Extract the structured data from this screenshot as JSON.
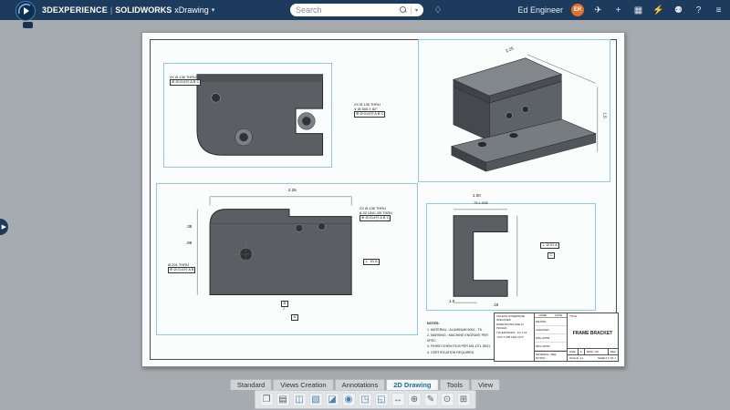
{
  "topbar": {
    "brand": {
      "name": "3DEXPERIENCE",
      "divider": "|",
      "app": "SOLIDWORKS",
      "doc": "xDrawing",
      "caret": "▾"
    },
    "search": {
      "placeholder": "Search",
      "chevron": "▾",
      "tag_glyph": "♢"
    },
    "user": {
      "name": "Ed Engineer",
      "initials": "ER"
    },
    "icons": [
      {
        "name": "share-icon",
        "glyph": "✈"
      },
      {
        "name": "add-icon",
        "glyph": "+"
      },
      {
        "name": "apps-grid-icon",
        "glyph": "▦"
      },
      {
        "name": "flash-icon",
        "glyph": "⚡"
      },
      {
        "name": "community-icon",
        "glyph": "⚉"
      },
      {
        "name": "help-icon",
        "glyph": "?"
      },
      {
        "name": "menu-icon",
        "glyph": "≡"
      }
    ]
  },
  "sheet": {
    "annotations": {
      "v1_note1": {
        "line1": "4X Ø.136 THRU",
        "fcf": "⊕ Ø.014Ⓜ A B C"
      },
      "v1_note2": {
        "line1": "2X Ø.136 THRU",
        "line2": "∨ Ø.385 X 82°",
        "fcf": "⊕ Ø.014Ⓜ A B C"
      },
      "v2_dim_top": "2.25",
      "v2_dim_right": "1.5",
      "v3_dim_top": "2.25",
      "v3_dim_left_upper": ".38",
      "v3_dim_left_lower": ".88",
      "v3_note1": {
        "line1": "Ø.201 THRU",
        "fcf": "⊕ Ø.014Ⓜ A B"
      },
      "v3_note2": {
        "line1": "2X Ø.136 THRU",
        "line2": "8-32 UNC-2B THRU",
        "fcf": "⊕ Ø.014Ⓜ A B C"
      },
      "v3_fcf_right": "⊥ .01 A",
      "v3_datum_b": "B",
      "v3_datum_a": "A",
      "v4_dim_top": "1.00",
      "v4_dim_top2": ".75 ±.005",
      "v4_fcf": "⊥ Ø.01 A",
      "v4_datum_c": "C",
      "v4_dim_bottom1": "1.0",
      "v4_dim_bottom2": ".15"
    },
    "notes": {
      "title": "NOTES:",
      "lines": [
        "1. MATERIAL : ALUMINUM 6061 - T6",
        "2. MARKING : MACHINE ENGRAVE PER SPEC",
        "3. FINISH CHEM FILM PER MIL-DTL-5541",
        "4. CERTIFICATION REQUIRED"
      ]
    },
    "title_block": {
      "spec_lines": [
        "UNLESS OTHERWISE SPECIFIED",
        "DIMENSIONS ARE IN INCHES",
        "TOLERANCES: .XX ±.01",
        ".XXX ±.005  ANG ±0.5°"
      ],
      "name_header": "NAME",
      "date_header": "DATE",
      "rows": [
        "DRAWN",
        "CHECKED",
        "ENG APPR.",
        "MFG APPR."
      ],
      "title_label": "TITLE:",
      "part_name": "FRAME BRACKET",
      "size_label": "SIZE",
      "size": "A",
      "dwg_label": "DWG. NO.",
      "rev_label": "REV",
      "scale_text": "SCALE: 1:1",
      "sheet_text": "SHEET 1 OF 1",
      "material_label": "MATERIAL:",
      "material": "SEE NOTES"
    }
  },
  "tabs": {
    "items": [
      {
        "label": "Standard"
      },
      {
        "label": "Views Creation"
      },
      {
        "label": "Annotations"
      },
      {
        "label": "2D Drawing"
      },
      {
        "label": "Tools"
      },
      {
        "label": "View"
      }
    ]
  },
  "toolbar": {
    "items": [
      {
        "name": "new-sheet-icon",
        "glyph": "❐"
      },
      {
        "name": "view-wizard-icon",
        "glyph": "▤"
      },
      {
        "name": "standard-views-icon",
        "glyph": "◫"
      },
      {
        "name": "projected-view-icon",
        "glyph": "▧"
      },
      {
        "name": "section-view-icon",
        "glyph": "◪"
      },
      {
        "name": "detail-view-icon",
        "glyph": "◉"
      },
      {
        "name": "crop-view-icon",
        "glyph": "◳"
      },
      {
        "name": "break-view-icon",
        "glyph": "◱"
      },
      {
        "name": "dimension-icon",
        "glyph": "↔"
      },
      {
        "name": "geometric-tolerance-icon",
        "glyph": "⊕"
      },
      {
        "name": "note-icon",
        "glyph": "✎"
      },
      {
        "name": "balloon-icon",
        "glyph": "⊙"
      },
      {
        "name": "table-icon",
        "glyph": "⊞"
      }
    ]
  }
}
